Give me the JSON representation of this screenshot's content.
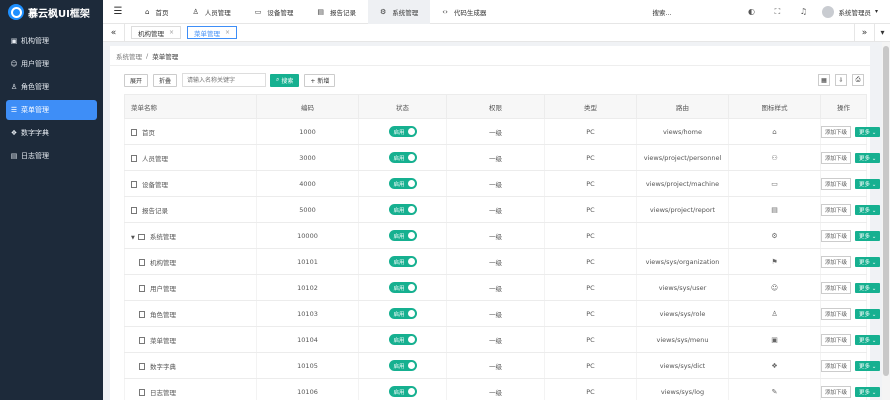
{
  "app": {
    "title": "慕云枫UI框架"
  },
  "sidebar": {
    "items": [
      {
        "label": "机构管理",
        "icon": "org-icon"
      },
      {
        "label": "用户管理",
        "icon": "user-icon"
      },
      {
        "label": "角色管理",
        "icon": "role-icon"
      },
      {
        "label": "菜单管理",
        "icon": "menu-icon",
        "active": true
      },
      {
        "label": "数字字典",
        "icon": "dict-icon"
      },
      {
        "label": "日志管理",
        "icon": "log-icon"
      }
    ]
  },
  "topbar": {
    "tabs": [
      {
        "label": "首页",
        "icon": "home-icon"
      },
      {
        "label": "人员管理",
        "icon": "user-icon"
      },
      {
        "label": "设备管理",
        "icon": "device-icon"
      },
      {
        "label": "报告记录",
        "icon": "report-icon"
      },
      {
        "label": "系统管理",
        "icon": "gear-icon",
        "active": true
      },
      {
        "label": "代码生成器",
        "icon": "code-icon"
      }
    ],
    "search_label": "搜索...",
    "user_name": "系统管理员"
  },
  "page_tabs": [
    {
      "label": "机构管理"
    },
    {
      "label": "菜单管理",
      "active": true
    }
  ],
  "breadcrumb": {
    "parent": "系统管理",
    "current": "菜单管理"
  },
  "toolbar": {
    "expand": "展开",
    "collapse": "折叠",
    "search_placeholder": "请输入名称关键字",
    "search_button": "搜索",
    "add_button": "+ 新增"
  },
  "table": {
    "headers": [
      "菜单名称",
      "编码",
      "状态",
      "权限",
      "类型",
      "路由",
      "图标样式",
      "操作"
    ],
    "status_label": "启用",
    "add_sub_label": "添加下级",
    "more_label": "更多",
    "rows": [
      {
        "name": "首页",
        "code": "1000",
        "perm": "一级",
        "type": "PC",
        "route": "views/home",
        "icon": "⌂"
      },
      {
        "name": "人员管理",
        "code": "3000",
        "perm": "一级",
        "type": "PC",
        "route": "views/project/personnel",
        "icon": "⚇"
      },
      {
        "name": "设备管理",
        "code": "4000",
        "perm": "一级",
        "type": "PC",
        "route": "views/project/machine",
        "icon": "▭"
      },
      {
        "name": "报告记录",
        "code": "5000",
        "perm": "一级",
        "type": "PC",
        "route": "views/project/report",
        "icon": "▤"
      },
      {
        "name": "系统管理",
        "code": "10000",
        "perm": "一级",
        "type": "PC",
        "route": "",
        "icon": "⚙",
        "folder": true
      },
      {
        "name": "机构管理",
        "code": "10101",
        "perm": "一级",
        "type": "PC",
        "route": "views/sys/organization",
        "icon": "⚑",
        "child": true
      },
      {
        "name": "用户管理",
        "code": "10102",
        "perm": "一级",
        "type": "PC",
        "route": "views/sys/user",
        "icon": "☺",
        "child": true
      },
      {
        "name": "角色管理",
        "code": "10103",
        "perm": "一级",
        "type": "PC",
        "route": "views/sys/role",
        "icon": "♙",
        "child": true
      },
      {
        "name": "菜单管理",
        "code": "10104",
        "perm": "一级",
        "type": "PC",
        "route": "views/sys/menu",
        "icon": "▣",
        "child": true
      },
      {
        "name": "数字字典",
        "code": "10105",
        "perm": "一级",
        "type": "PC",
        "route": "views/sys/dict",
        "icon": "❖",
        "child": true
      },
      {
        "name": "日志管理",
        "code": "10106",
        "perm": "一级",
        "type": "PC",
        "route": "views/sys/log",
        "icon": "✎",
        "child": true
      }
    ]
  }
}
